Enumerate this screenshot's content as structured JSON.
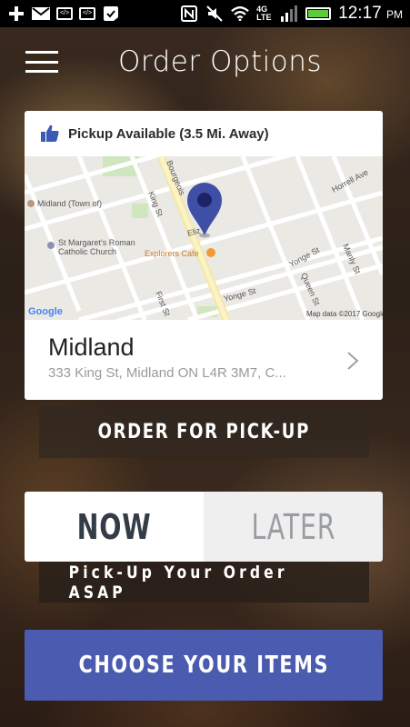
{
  "status_bar": {
    "time": "12:17",
    "ampm": "PM",
    "network": "4G LTE",
    "icons": [
      "add-icon",
      "gmail-icon",
      "code-icon",
      "code-icon",
      "check-icon",
      "nfc-icon",
      "mute-icon",
      "wifi-icon",
      "signal-icon",
      "battery-icon"
    ]
  },
  "header": {
    "title": "Order Options"
  },
  "location_card": {
    "pickup_label": "Pickup Available (3.5 Mi. Away)",
    "location_name": "Midland",
    "location_address": "333 King St, Midland ON L4R 3M7, C...",
    "map": {
      "labels": {
        "midland_town": "Midland (Town of)",
        "st_margarets": "St Margaret's Roman",
        "st_margarets_2": "Catholic Church",
        "explorers": "Explorers Cafe",
        "king_st": "King St",
        "bourgeois": "Bourgeois",
        "elizabeth": "Eliz",
        "yonge_st": "Yonge St",
        "yonge_st_2": "Yonge St",
        "queen_st": "Queen St",
        "first_st": "First St",
        "hurel_ave": "Horrell Ave",
        "manly_st": "Manly St",
        "google": "Google",
        "attribution": "Map data ©2017 Google"
      }
    }
  },
  "order_button": {
    "label": "ORDER FOR PICK-UP"
  },
  "timing": {
    "now_label": "NOW",
    "later_label": "LATER",
    "selected": "now",
    "asap_text": "Pick-Up Your Order ASAP"
  },
  "choose_button": {
    "label": "CHOOSE YOUR ITEMS"
  },
  "colors": {
    "accent": "#4a5bb0",
    "pin": "#3f4fa6",
    "thumb": "#3a5bb5"
  }
}
